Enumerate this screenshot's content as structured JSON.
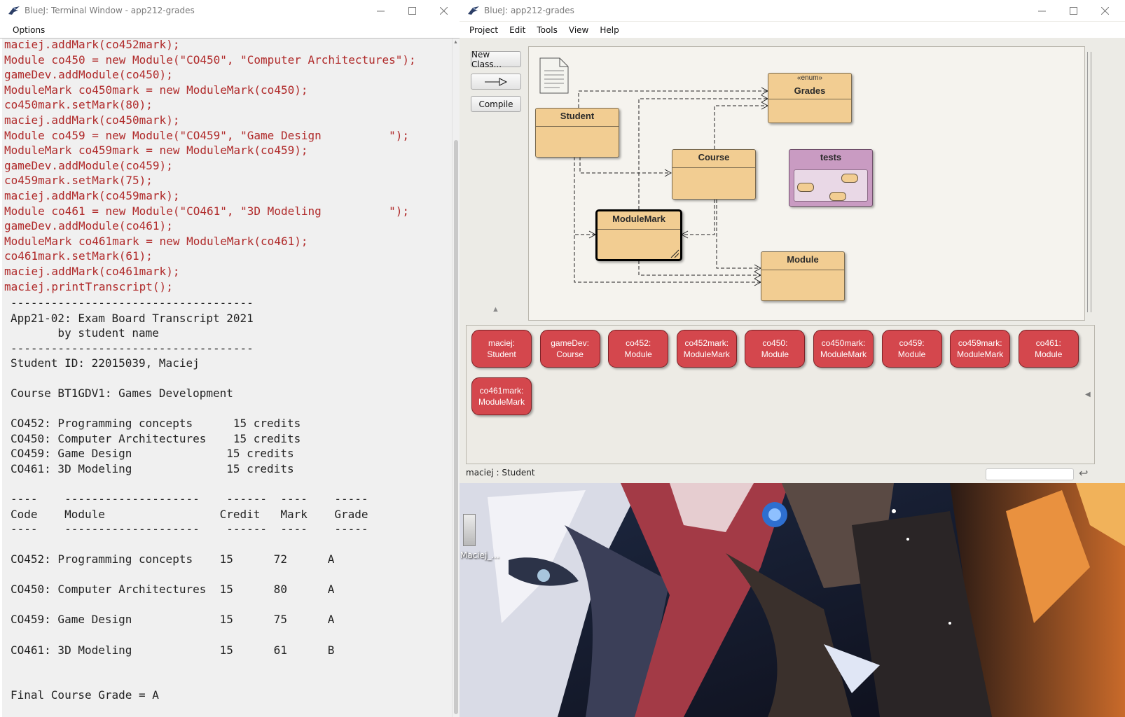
{
  "terminal": {
    "title": "BlueJ: Terminal Window - app212-grades",
    "menu": [
      "Options"
    ],
    "code_lines": [
      "maciej.addMark(co452mark);",
      "Module co450 = new Module(\"CO450\", \"Computer Architectures\");",
      "gameDev.addModule(co450);",
      "ModuleMark co450mark = new ModuleMark(co450);",
      "co450mark.setMark(80);",
      "maciej.addMark(co450mark);",
      "Module co459 = new Module(\"CO459\", \"Game Design          \");",
      "ModuleMark co459mark = new ModuleMark(co459);",
      "gameDev.addModule(co459);",
      "co459mark.setMark(75);",
      "maciej.addMark(co459mark);",
      "Module co461 = new Module(\"CO461\", \"3D Modeling          \");",
      "gameDev.addModule(co461);",
      "ModuleMark co461mark = new ModuleMark(co461);",
      "co461mark.setMark(61);",
      "maciej.addMark(co461mark);",
      "maciej.printTranscript();"
    ],
    "output_lines": [
      "------------------------------------",
      "App21-02: Exam Board Transcript 2021",
      "       by student name",
      "------------------------------------",
      "Student ID: 22015039, Maciej",
      "",
      "Course BT1GDV1: Games Development",
      "",
      "CO452: Programming concepts      15 credits",
      "CO450: Computer Architectures    15 credits",
      "CO459: Game Design              15 credits",
      "CO461: 3D Modeling              15 credits",
      "",
      "----    --------------------    ------  ----    -----",
      "Code    Module                 Credit   Mark    Grade",
      "----    --------------------    ------  ----    -----",
      "",
      "CO452: Programming concepts    15      72      A",
      "",
      "CO450: Computer Architectures  15      80      A",
      "",
      "CO459: Game Design             15      75      A",
      "",
      "CO461: 3D Modeling             15      61      B",
      "",
      "",
      "Final Course Grade = A"
    ]
  },
  "main": {
    "title": "BlueJ:  app212-grades",
    "menu": [
      "Project",
      "Edit",
      "Tools",
      "View",
      "Help"
    ],
    "toolbar": {
      "new_class": "New Class...",
      "compile": "Compile"
    },
    "classes": {
      "grades_stereotype": "«enum»",
      "grades": "Grades",
      "student": "Student",
      "course": "Course",
      "tests": "tests",
      "module_mark": "ModuleMark",
      "module": "Module"
    },
    "objects": [
      {
        "name": "maciej:",
        "type": "Student"
      },
      {
        "name": "gameDev:",
        "type": "Course"
      },
      {
        "name": "co452:",
        "type": "Module"
      },
      {
        "name": "co452mark:",
        "type": "ModuleMark"
      },
      {
        "name": "co450:",
        "type": "Module"
      },
      {
        "name": "co450mark:",
        "type": "ModuleMark"
      },
      {
        "name": "co459:",
        "type": "Module"
      },
      {
        "name": "co459mark:",
        "type": "ModuleMark"
      },
      {
        "name": "co461:",
        "type": "Module"
      },
      {
        "name": "co461mark:",
        "type": "ModuleMark"
      }
    ],
    "status": "maciej : Student"
  },
  "desktop": {
    "icon_label": "Maciej_..."
  },
  "colors": {
    "class_fill": "#f2cd92",
    "object_fill": "#d4474d",
    "code_text": "#b02a2a",
    "test_fill": "#c99bc2"
  }
}
